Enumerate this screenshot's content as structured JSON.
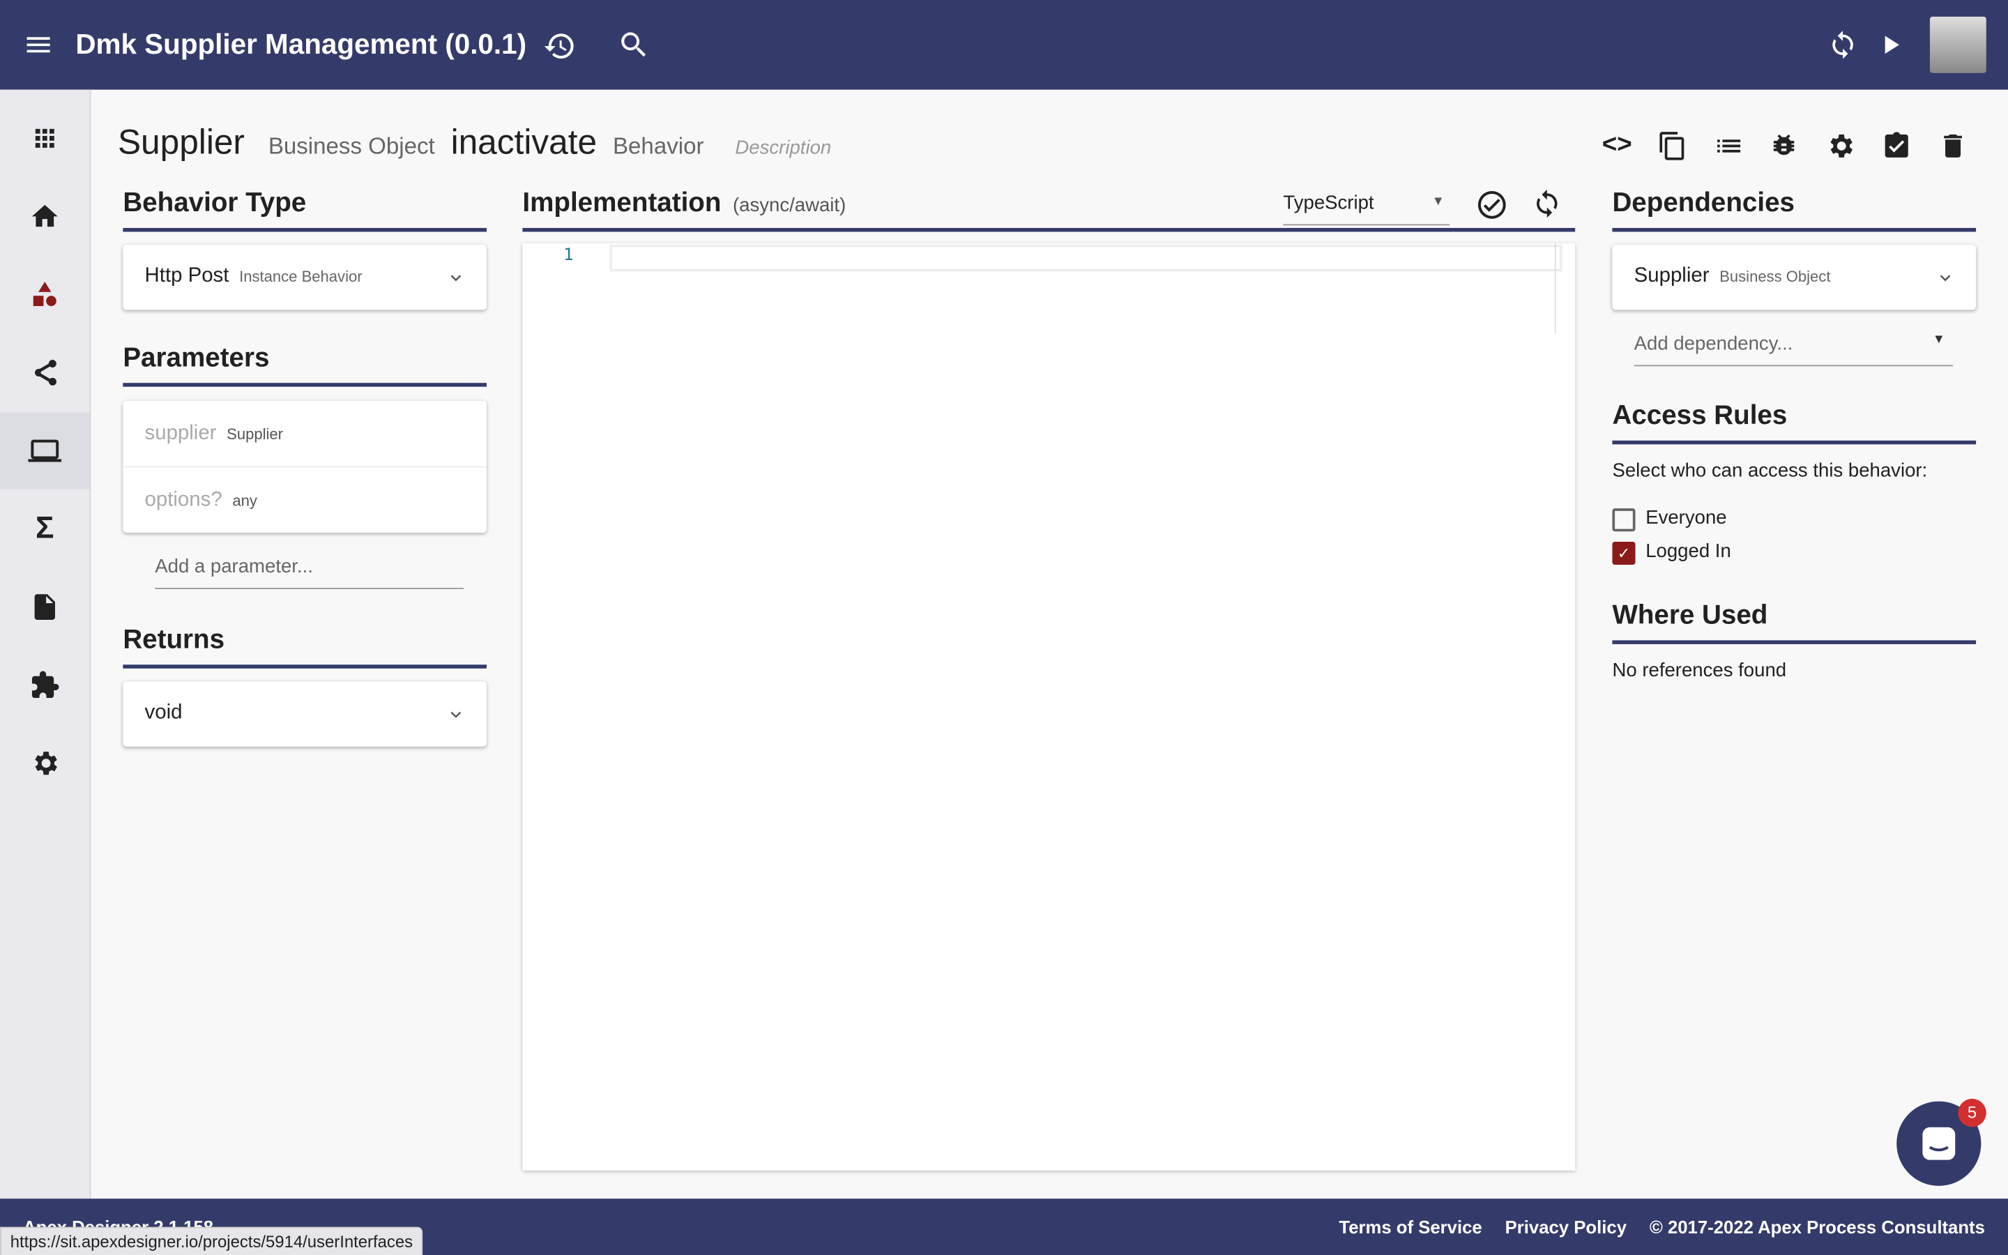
{
  "app": {
    "title": "Dmk Supplier Management (0.0.1)"
  },
  "header": {
    "object_name": "Supplier",
    "object_type": "Business Object",
    "behavior_name": "inactivate",
    "behavior_type": "Behavior",
    "description_placeholder": "Description"
  },
  "behavior_type": {
    "heading": "Behavior Type",
    "value": "Http Post",
    "sub": "Instance Behavior"
  },
  "parameters": {
    "heading": "Parameters",
    "items": [
      {
        "name": "supplier",
        "type": "Supplier"
      },
      {
        "name": "options?",
        "type": "any"
      }
    ],
    "add_placeholder": "Add a parameter..."
  },
  "returns": {
    "heading": "Returns",
    "value": "void"
  },
  "implementation": {
    "heading": "Implementation",
    "sub": "(async/await)",
    "language": "TypeScript",
    "line_number": "1"
  },
  "dependencies": {
    "heading": "Dependencies",
    "items": [
      {
        "name": "Supplier",
        "type": "Business Object"
      }
    ],
    "add_placeholder": "Add dependency..."
  },
  "access_rules": {
    "heading": "Access Rules",
    "prompt": "Select who can access this behavior:",
    "options": [
      {
        "label": "Everyone",
        "checked": false
      },
      {
        "label": "Logged In",
        "checked": true
      }
    ]
  },
  "where_used": {
    "heading": "Where Used",
    "text": "No references found"
  },
  "footer": {
    "version": "Apex Designer 2.1.158",
    "terms": "Terms of Service",
    "privacy": "Privacy Policy",
    "copyright": "© 2017-2022 Apex Process Consultants"
  },
  "status_url": "https://sit.apexdesigner.io/projects/5914/userInterfaces",
  "chat": {
    "badge": "5"
  },
  "colors": {
    "primary": "#343b6a",
    "accent": "#8b1a1a",
    "badge": "#d32f2f"
  }
}
